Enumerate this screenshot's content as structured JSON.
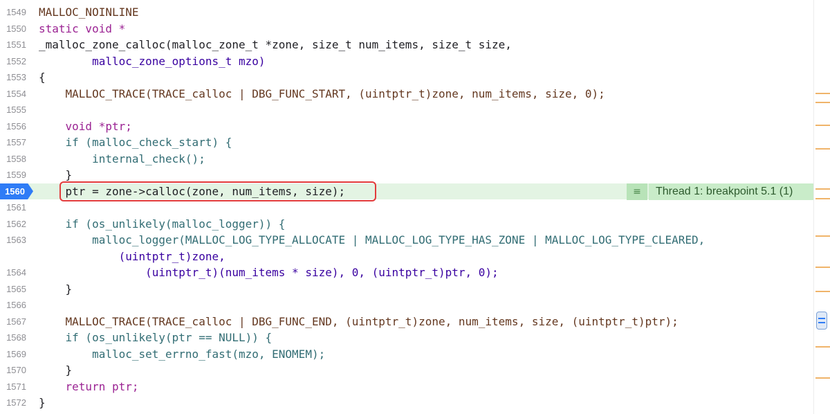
{
  "lines": [
    {
      "num": "1549",
      "code": "MALLOC_NOINLINE"
    },
    {
      "num": "1550",
      "code": "static void *"
    },
    {
      "num": "1551",
      "code": "_malloc_zone_calloc(malloc_zone_t *zone, size_t num_items, size_t size,"
    },
    {
      "num": "1552",
      "code": "        malloc_zone_options_t mzo)"
    },
    {
      "num": "1553",
      "code": "{"
    },
    {
      "num": "1554",
      "code": "    MALLOC_TRACE(TRACE_calloc | DBG_FUNC_START, (uintptr_t)zone, num_items, size, 0);"
    },
    {
      "num": "1555",
      "code": ""
    },
    {
      "num": "1556",
      "code": "    void *ptr;"
    },
    {
      "num": "1557",
      "code": "    if (malloc_check_start) {"
    },
    {
      "num": "1558",
      "code": "        internal_check();"
    },
    {
      "num": "1559",
      "code": "    }"
    },
    {
      "num": "1560",
      "code": "    ptr = zone->calloc(zone, num_items, size);"
    },
    {
      "num": "1561",
      "code": ""
    },
    {
      "num": "1562",
      "code": "    if (os_unlikely(malloc_logger)) {"
    },
    {
      "num": "1563",
      "code": "        malloc_logger(MALLOC_LOG_TYPE_ALLOCATE | MALLOC_LOG_TYPE_HAS_ZONE | MALLOC_LOG_TYPE_CLEARED,"
    },
    {
      "num": "",
      "code": "            (uintptr_t)zone,"
    },
    {
      "num": "1564",
      "code": "                (uintptr_t)(num_items * size), 0, (uintptr_t)ptr, 0);"
    },
    {
      "num": "1565",
      "code": "    }"
    },
    {
      "num": "1566",
      "code": ""
    },
    {
      "num": "1567",
      "code": "    MALLOC_TRACE(TRACE_calloc | DBG_FUNC_END, (uintptr_t)zone, num_items, size, (uintptr_t)ptr);"
    },
    {
      "num": "1568",
      "code": "    if (os_unlikely(ptr == NULL)) {"
    },
    {
      "num": "1569",
      "code": "        malloc_set_errno_fast(mzo, ENOMEM);"
    },
    {
      "num": "1570",
      "code": "    }"
    },
    {
      "num": "1571",
      "code": "    return ptr;"
    },
    {
      "num": "1572",
      "code": "}"
    }
  ],
  "breakpoint": {
    "line_num": "1560",
    "label": "Thread 1: breakpoint 5.1 (1)",
    "icon": "list-icon"
  },
  "colors": {
    "keyword": "#9b2393",
    "type": "#3900a0",
    "function": "#326d74",
    "macro": "#643820",
    "number": "#1c00cf",
    "breakpoint_blue": "#2f7cf6",
    "breakpoint_bg": "#e3f4e3",
    "highlight_red": "#e23b3b"
  }
}
